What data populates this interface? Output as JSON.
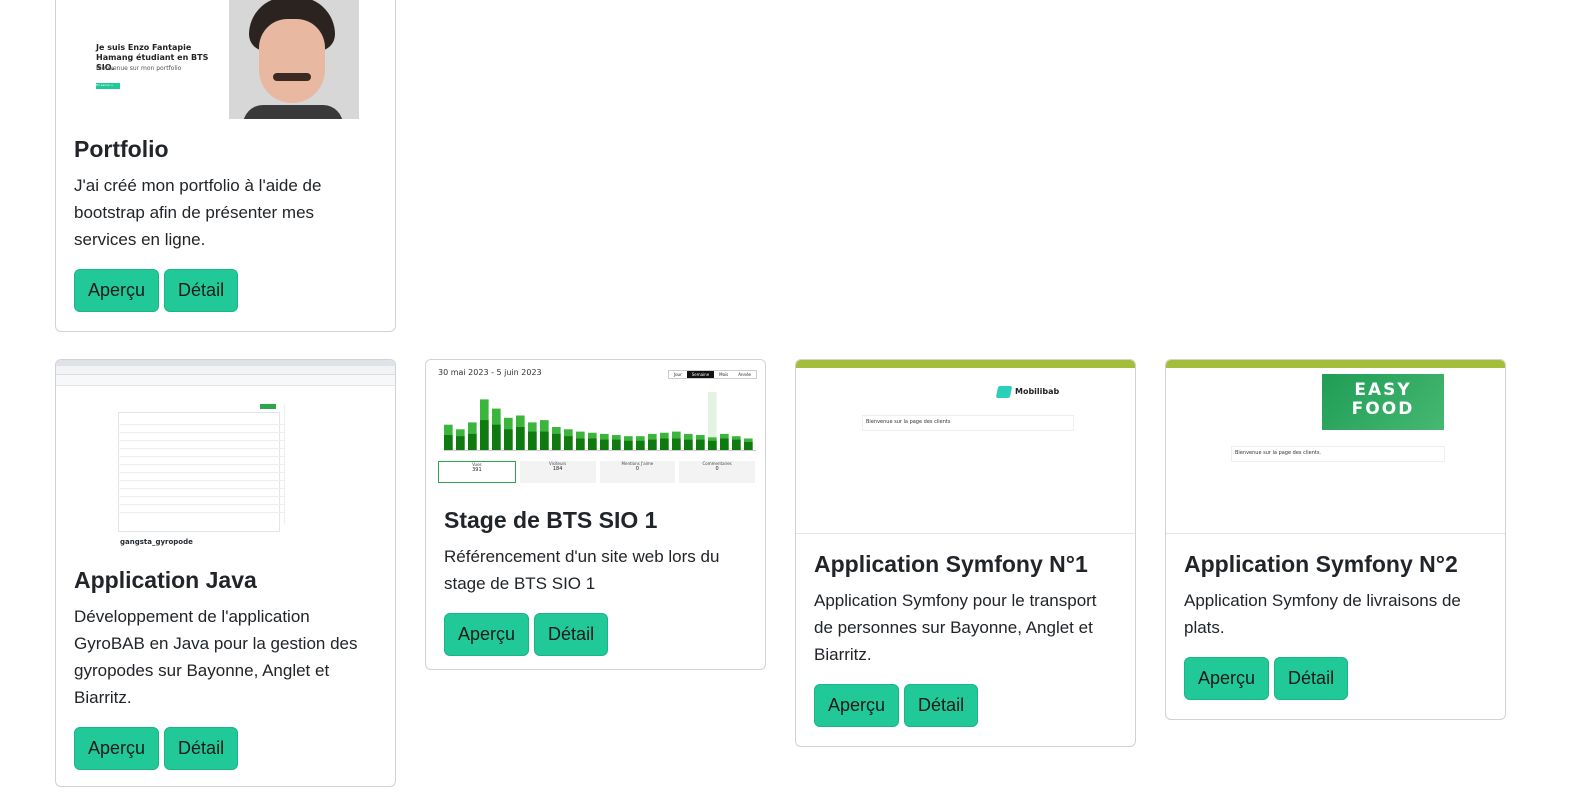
{
  "colors": {
    "accent": "#20c997",
    "olive": "#a5be3a",
    "chart_green": "#1a9a1a"
  },
  "cards": [
    {
      "title": "Portfolio",
      "text": "J'ai créé mon portfolio à l'aide de bootstrap afin de présenter mes services en ligne.",
      "preview": "Aperçu",
      "detail": "Détail",
      "thumb": {
        "heading": "Je suis Enzo Fantapie Hamang étudiant en BTS SIO.",
        "sub": "Bienvenue sur mon portfolio",
        "btn": "En savoir +"
      }
    },
    {
      "title": "Application Java",
      "text": "Développement de l'application GyroBAB en Java pour la gestion des gyropodes sur Bayonne, Anglet et Biarritz.",
      "preview": "Aperçu",
      "detail": "Détail",
      "thumb": {
        "repo": "gangsta_gyropode"
      }
    },
    {
      "title": "Stage de BTS SIO 1",
      "text": "Référencement d'un site web lors du stage de BTS SIO 1",
      "preview": "Aperçu",
      "detail": "Détail",
      "thumb": {
        "date_range": "30 mai 2023 - 5 juin 2023",
        "ranges": [
          "Jour",
          "Semaine",
          "Mois",
          "Année"
        ],
        "stats": [
          {
            "label": "Vues",
            "value": "391"
          },
          {
            "label": "Visiteurs",
            "value": "184"
          },
          {
            "label": "Mentions J'aime",
            "value": "0"
          },
          {
            "label": "Commentaires",
            "value": "0"
          }
        ]
      }
    },
    {
      "title": "Application Symfony N°1",
      "text": "Application Symfony pour le transport de personnes sur Bayonne, Anglet et Biarritz.",
      "preview": "Aperçu",
      "detail": "Détail",
      "thumb": {
        "brand": "Mobilibab",
        "welcome": "Bienvenue sur la page des clients"
      }
    },
    {
      "title": "Application Symfony N°2",
      "text": "Application Symfony de livraisons de plats.",
      "preview": "Aperçu",
      "detail": "Détail",
      "thumb": {
        "logo_line1": "EASY",
        "logo_line2": "FOOD",
        "welcome": "Bienvenue sur la page des clients."
      }
    }
  ],
  "chart_data": {
    "type": "bar",
    "title": "30 mai 2023 - 5 juin 2023",
    "series": [
      {
        "values": [
          22,
          18,
          24,
          44,
          36,
          28,
          30,
          24,
          26,
          20,
          18,
          16,
          15,
          14,
          13,
          12,
          12,
          14,
          15,
          16,
          14,
          13,
          11,
          14,
          12,
          10
        ]
      },
      {
        "values": [
          13,
          12,
          14,
          26,
          22,
          18,
          20,
          16,
          16,
          14,
          12,
          10,
          10,
          9,
          9,
          8,
          8,
          9,
          10,
          10,
          9,
          9,
          8,
          10,
          9,
          7
        ]
      }
    ]
  }
}
